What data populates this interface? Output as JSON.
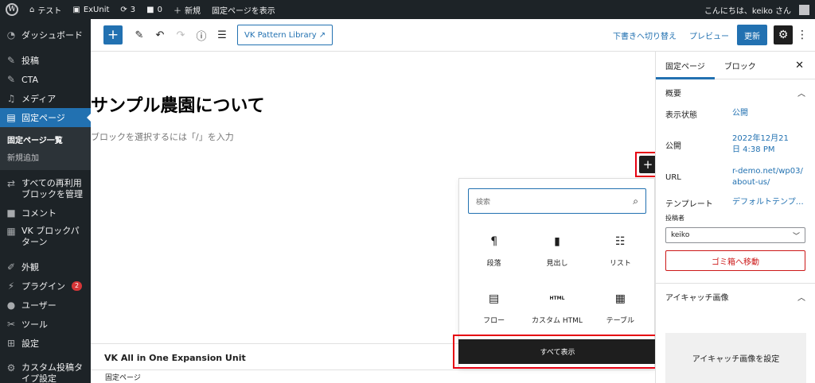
{
  "adminbar": {
    "site_name": "テスト",
    "exunit": "ExUnit",
    "updates_count": "3",
    "comments_count": "0",
    "new_label": "新規",
    "view_page": "固定ページを表示",
    "greeting": "こんにちは、keiko さん"
  },
  "sidebar": {
    "items": [
      {
        "label": "ダッシュボード",
        "icon": "gauge-icon"
      },
      {
        "label": "投稿",
        "icon": "pin-icon"
      },
      {
        "label": "CTA",
        "icon": "pin-icon"
      },
      {
        "label": "メディア",
        "icon": "media-icon"
      },
      {
        "label": "固定ページ",
        "icon": "page-icon"
      }
    ],
    "sub": {
      "all_pages": "固定ページ一覧",
      "add_new": "新規追加"
    },
    "items2": [
      {
        "label": "すべての再利用ブロックを管理",
        "icon": "reusable-icon"
      },
      {
        "label": "コメント",
        "icon": "comment-icon"
      },
      {
        "label": "VK ブロックパターン",
        "icon": "grid-icon"
      },
      {
        "label": "外観",
        "icon": "brush-icon"
      },
      {
        "label": "プラグイン",
        "icon": "plugin-icon",
        "badge": "2"
      },
      {
        "label": "ユーザー",
        "icon": "user-icon"
      },
      {
        "label": "ツール",
        "icon": "wrench-icon"
      },
      {
        "label": "設定",
        "icon": "settings-icon"
      },
      {
        "label": "カスタム投稿タイプ設定",
        "icon": "gear-icon"
      }
    ]
  },
  "toolbar": {
    "vk_pattern": "VK Pattern Library",
    "save_draft": "下書きへ切り替え",
    "preview": "プレビュー",
    "update": "更新"
  },
  "editor": {
    "title": "サンプル農園について",
    "placeholder": "ブロックを選択するには「/」を入力",
    "meta_box": "VK All in One Expansion Unit",
    "footer_breadcrumb": "固定ページ"
  },
  "inserter": {
    "search_placeholder": "検索",
    "blocks": [
      {
        "label": "段落",
        "icon": "paragraph-icon"
      },
      {
        "label": "見出し",
        "icon": "bookmark-icon"
      },
      {
        "label": "リスト",
        "icon": "list-icon"
      },
      {
        "label": "フロー",
        "icon": "flow-icon"
      },
      {
        "label": "カスタム HTML",
        "icon": "html-icon",
        "glyph": "HTML"
      },
      {
        "label": "テーブル",
        "icon": "table-icon"
      }
    ],
    "show_all": "すべて表示"
  },
  "settings": {
    "tab_page": "固定ページ",
    "tab_block": "ブロック",
    "summary": "概要",
    "visibility_label": "表示状態",
    "visibility_value": "公開",
    "publish_label": "公開",
    "publish_value": "2022年12月21日 4:38 PM",
    "url_label": "URL",
    "url_value": "r-demo.net/wp03/about-us/",
    "template_label": "テンプレート",
    "template_value": "デフォルトテンプ…",
    "author_label": "投稿者",
    "author_value": "keiko",
    "trash": "ゴミ箱へ移動",
    "featured_image": "アイキャッチ画像",
    "set_featured": "アイキャッチ画像を設定"
  },
  "colors": {
    "accent": "#2271b1",
    "highlight": "#e60012",
    "admin_dark": "#1d2327"
  }
}
